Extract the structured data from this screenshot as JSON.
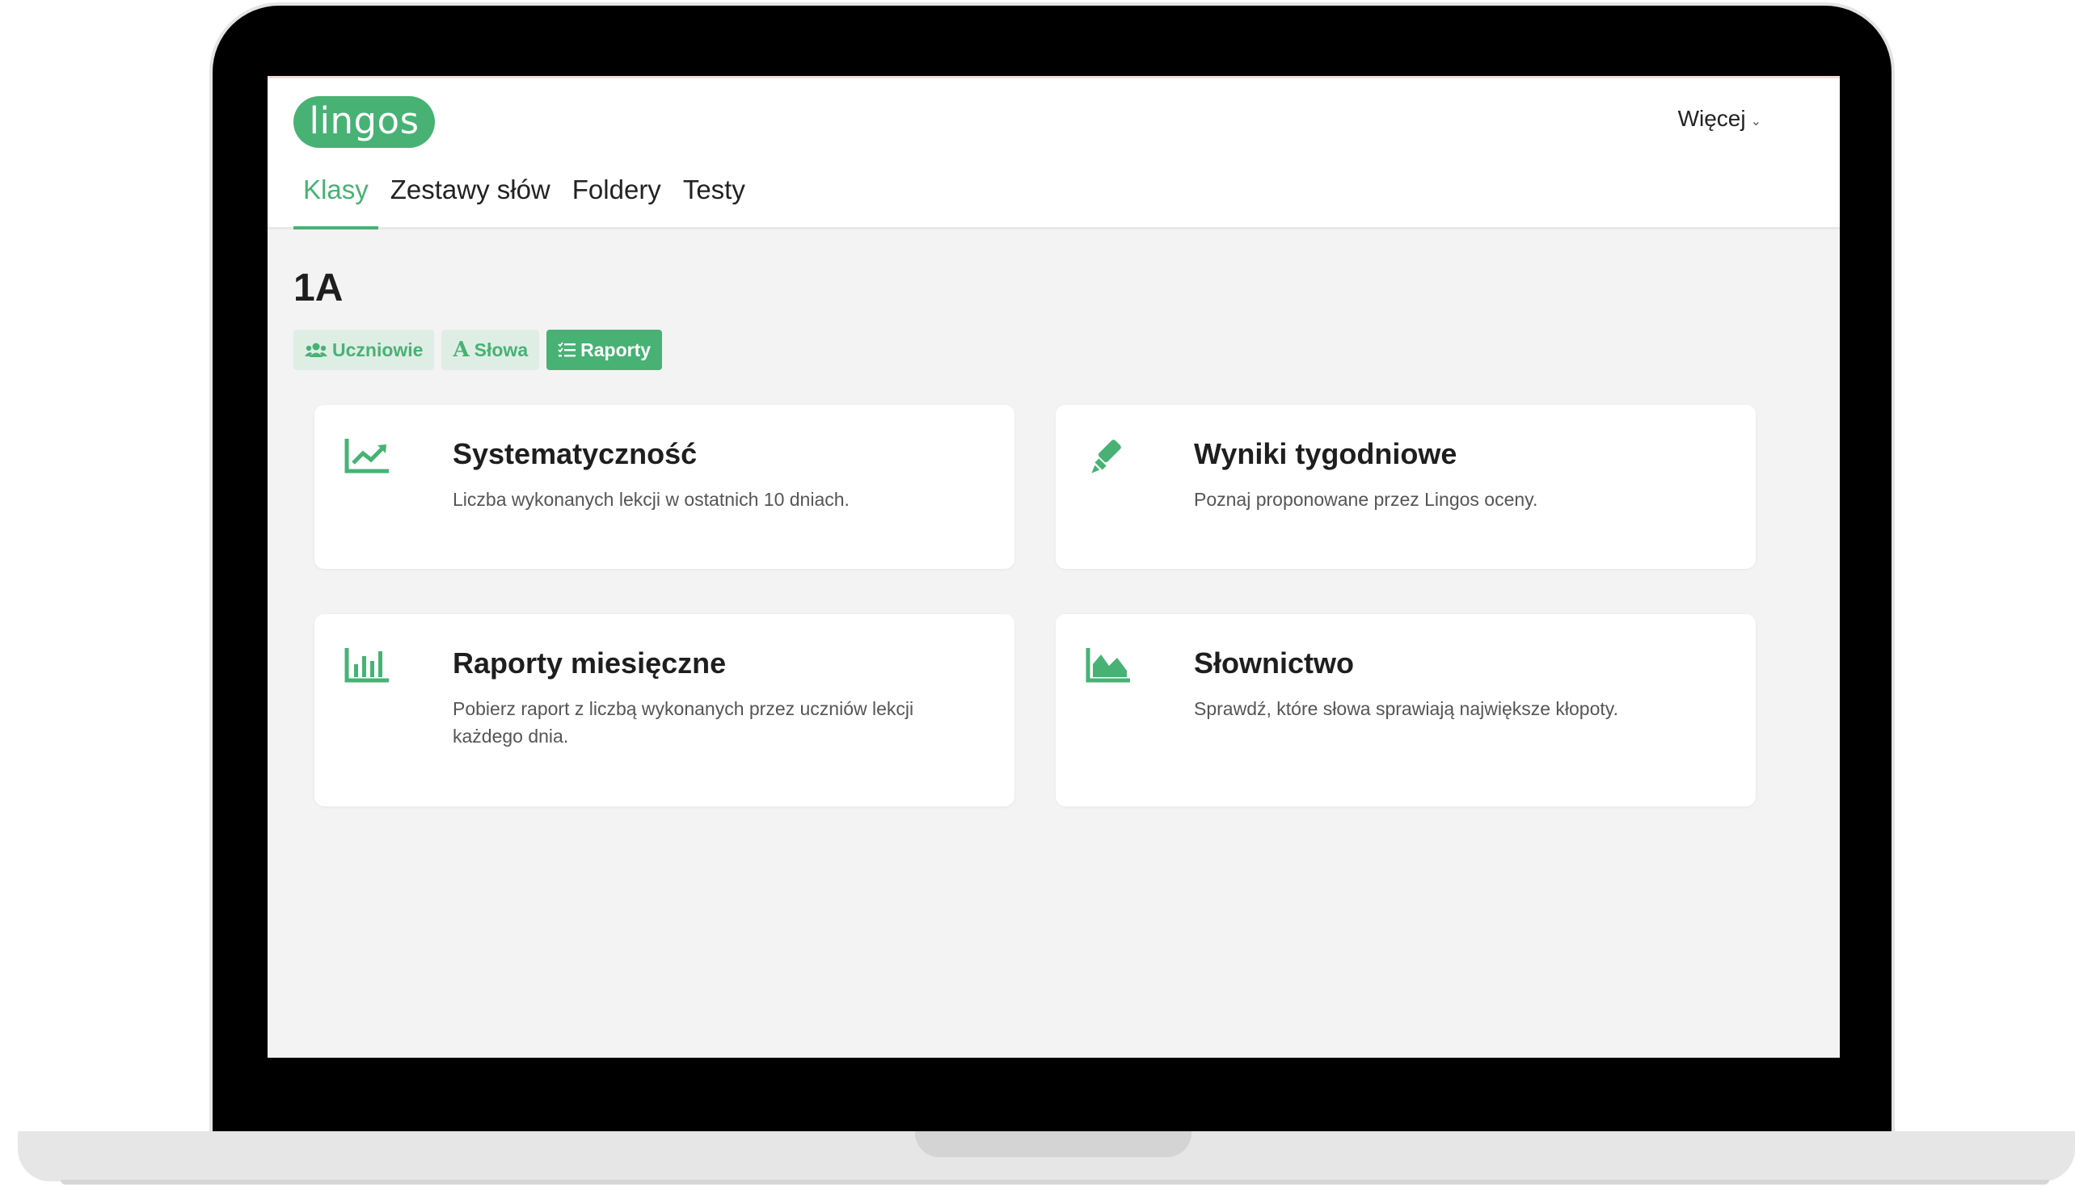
{
  "app": {
    "logo": "lingos",
    "more_label": "Więcej"
  },
  "nav": {
    "tabs": [
      {
        "label": "Klasy",
        "active": true
      },
      {
        "label": "Zestawy słów",
        "active": false
      },
      {
        "label": "Foldery",
        "active": false
      },
      {
        "label": "Testy",
        "active": false
      }
    ]
  },
  "class_page": {
    "title": "1A",
    "subtabs": [
      {
        "label": "Uczniowie",
        "icon": "users-icon",
        "active": false
      },
      {
        "label": "Słowa",
        "icon": "letter-a-icon",
        "active": false
      },
      {
        "label": "Raporty",
        "icon": "list-icon",
        "active": true
      }
    ]
  },
  "reports": [
    {
      "title": "Systematyczność",
      "description": "Liczba wykonanych lekcji w ostatnich 10 dniach.",
      "icon": "line-chart-icon"
    },
    {
      "title": "Wyniki tygodniowe",
      "description": "Poznaj proponowane przez Lingos oceny.",
      "icon": "highlighter-icon"
    },
    {
      "title": "Raporty miesięczne",
      "description": "Pobierz raport z liczbą wykonanych przez uczniów lekcji każdego dnia.",
      "icon": "bar-chart-icon"
    },
    {
      "title": "Słownictwo",
      "description": "Sprawdź, które słowa sprawiają największe kłopoty.",
      "icon": "area-chart-icon"
    }
  ],
  "colors": {
    "accent": "#47b274",
    "accent_light": "#dfeee5",
    "background": "#f3f3f3"
  }
}
